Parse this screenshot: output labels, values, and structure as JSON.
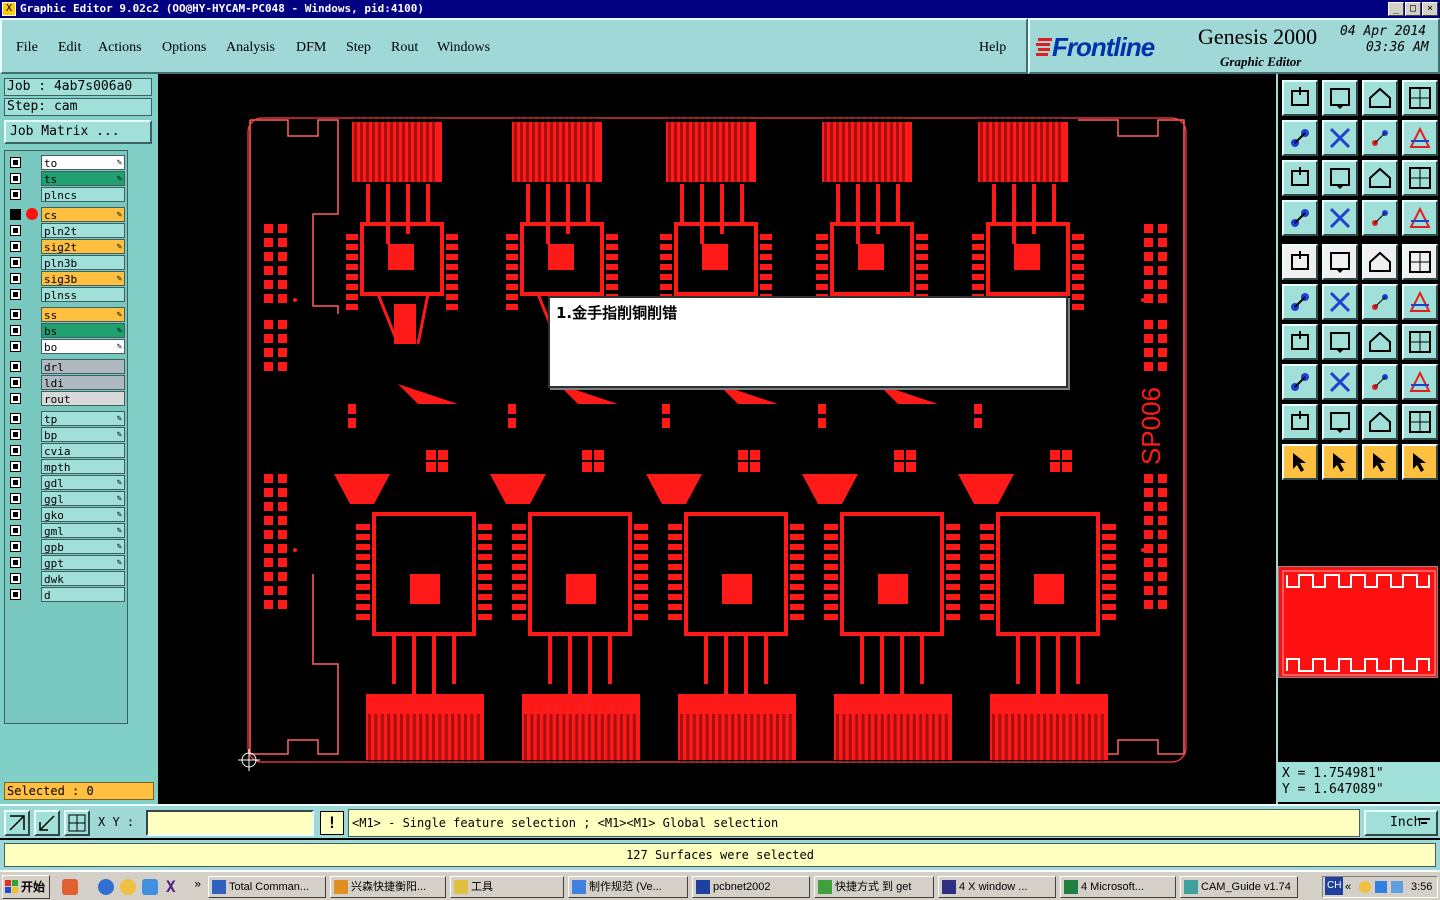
{
  "window": {
    "title": "Graphic Editor 9.02c2 (OO@HY-HYCAM-PC048 - Windows, pid:4100)",
    "minimize": "_",
    "maximize": "□",
    "close": "×"
  },
  "menu": {
    "file": "File",
    "edit": "Edit",
    "actions": "Actions",
    "options": "Options",
    "analysis": "Analysis",
    "dfm": "DFM",
    "step": "Step",
    "rout": "Rout",
    "windows": "Windows",
    "help": "Help"
  },
  "brand": {
    "logo": "Frontline",
    "product": "Genesis 2000",
    "subtitle": "Graphic Editor",
    "date": "04 Apr 2014",
    "time": "03:36 AM"
  },
  "job": {
    "job_line": "Job : 4ab7s006a0",
    "step_line": "Step: cam",
    "matrix_button": "Job Matrix ..."
  },
  "layers": [
    {
      "name": "to",
      "color": "#ffffff",
      "edit": true
    },
    {
      "name": "ts",
      "color": "#20a070",
      "edit": true
    },
    {
      "name": "plncs",
      "color": "#a0e0d8",
      "edit": false
    },
    {
      "name": "cs",
      "color": "#ffc040",
      "edit": true
    },
    {
      "name": "pln2t",
      "color": "#a0e0d8",
      "edit": false
    },
    {
      "name": "sig2t",
      "color": "#ffc040",
      "edit": true
    },
    {
      "name": "pln3b",
      "color": "#a0e0d8",
      "edit": false
    },
    {
      "name": "sig3b",
      "color": "#ffc040",
      "edit": true
    },
    {
      "name": "plnss",
      "color": "#a0e0d8",
      "edit": false
    },
    {
      "name": "ss",
      "color": "#ffc040",
      "edit": true
    },
    {
      "name": "bs",
      "color": "#20a070",
      "edit": true
    },
    {
      "name": "bo",
      "color": "#ffffff",
      "edit": true
    },
    {
      "name": "drl",
      "color": "#b0b8c0",
      "edit": false
    },
    {
      "name": "ldi",
      "color": "#b0b8c0",
      "edit": false
    },
    {
      "name": "rout",
      "color": "#d8d8d8",
      "edit": false
    },
    {
      "name": "tp",
      "color": "#a0e0d8",
      "edit": true
    },
    {
      "name": "bp",
      "color": "#a0e0d8",
      "edit": true
    },
    {
      "name": "cvia",
      "color": "#a0e0d8",
      "edit": false
    },
    {
      "name": "mpth",
      "color": "#a0e0d8",
      "edit": false
    },
    {
      "name": "gdl",
      "color": "#a0e0d8",
      "edit": true
    },
    {
      "name": "ggl",
      "color": "#a0e0d8",
      "edit": true
    },
    {
      "name": "gko",
      "color": "#a0e0d8",
      "edit": true
    },
    {
      "name": "gml",
      "color": "#a0e0d8",
      "edit": true
    },
    {
      "name": "gpb",
      "color": "#a0e0d8",
      "edit": true
    },
    {
      "name": "gpt",
      "color": "#a0e0d8",
      "edit": true
    },
    {
      "name": "dwk",
      "color": "#a0e0d8",
      "edit": false
    },
    {
      "name": "d",
      "color": "#a0e0d8",
      "edit": false
    }
  ],
  "selected": "Selected : 0",
  "popup_note": "1.金手指削铜削错",
  "board_label": "SP006",
  "coords": {
    "x": "X = 1.754981\"",
    "y": "Y = 1.647089\""
  },
  "status": {
    "xy_label": "X Y :",
    "xy_value": "",
    "warn": "!",
    "hint": "<M1> - Single feature selection ; <M1><M1> Global selection",
    "units": "Inch",
    "message": "127 Surfaces were selected"
  },
  "taskbar": {
    "start": "开始",
    "chevron": "»",
    "tasks": [
      {
        "label": "Total Comman...",
        "icon": "#3060c0"
      },
      {
        "label": "兴森快捷衡阳...",
        "icon": "#e09020"
      },
      {
        "label": "工具",
        "icon": "#e0c040"
      },
      {
        "label": "制作规范 (Ve...",
        "icon": "#4080e0"
      },
      {
        "label": "pcbnet2002",
        "icon": "#2040a0"
      },
      {
        "label": "快捷方式 到 get",
        "icon": "#40a040"
      },
      {
        "label": "4 X window ...",
        "icon": "#303080"
      },
      {
        "label": "4 Microsoft...",
        "icon": "#208040"
      },
      {
        "label": "CAM_Guide v1.74",
        "icon": "#40a0a0"
      }
    ],
    "tray_lang": "CH",
    "tray_arrow": "«",
    "clock": "3:56"
  },
  "colors": {
    "copper": "#ff1a1a",
    "panel": "#a0d8d8",
    "accent_active": "#ffc040"
  }
}
